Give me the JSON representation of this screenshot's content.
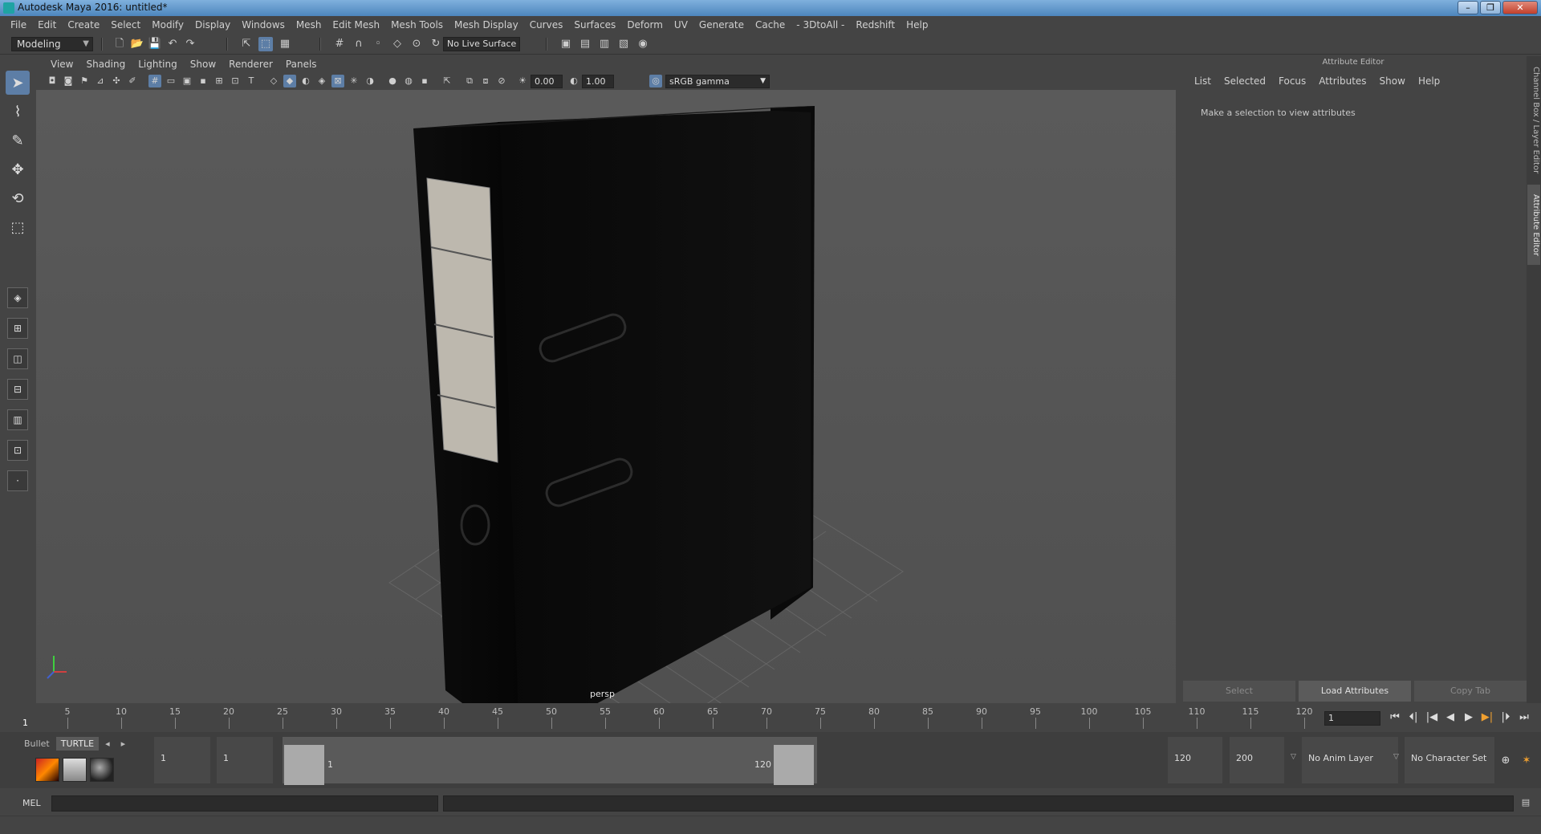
{
  "window": {
    "title": "Autodesk Maya 2016: untitled*",
    "controls": [
      "–",
      "❐",
      "✕"
    ]
  },
  "menubar": {
    "items": [
      "File",
      "Edit",
      "Create",
      "Select",
      "Modify",
      "Display",
      "Windows",
      "Mesh",
      "Edit Mesh",
      "Mesh Tools",
      "Mesh Display",
      "Curves",
      "Surfaces",
      "Deform",
      "UV",
      "Generate",
      "Cache",
      "- 3DtoAll -",
      "Redshift",
      "Help"
    ]
  },
  "statusline": {
    "mode": "Modeling",
    "live_surface": "No Live Surface"
  },
  "viewport": {
    "menus": [
      "View",
      "Shading",
      "Lighting",
      "Show",
      "Renderer",
      "Panels"
    ],
    "exposure": "0.00",
    "gamma": "1.00",
    "color_space": "sRGB gamma",
    "camera": "persp"
  },
  "attribute_editor": {
    "title": "Attribute Editor",
    "menus": [
      "List",
      "Selected",
      "Focus",
      "Attributes",
      "Show",
      "Help"
    ],
    "hint": "Make a selection to view attributes",
    "buttons": [
      "Select",
      "Load Attributes",
      "Copy Tab"
    ],
    "side_tabs": [
      "Channel Box / Layer Editor",
      "Attribute Editor"
    ]
  },
  "timeline": {
    "ticks": [
      5,
      10,
      15,
      20,
      25,
      30,
      35,
      40,
      45,
      50,
      55,
      60,
      65,
      70,
      75,
      80,
      85,
      90,
      95,
      100,
      105,
      110,
      115,
      120
    ],
    "start_label": "1",
    "current_frame": "1",
    "playback": [
      "⏮",
      "⏴|",
      "|◀",
      "◀",
      "▶",
      "▶|",
      "|⏵",
      "⏭"
    ]
  },
  "range": {
    "shelf_tabs": [
      "Bullet",
      "TURTLE"
    ],
    "start_time": "1",
    "playback_start": "1",
    "range_start_label": "1",
    "range_end_label": "120",
    "playback_end": "120",
    "end_time": "200",
    "anim_layer": "No Anim Layer",
    "character_set": "No Character Set"
  },
  "cmdline": {
    "label": "MEL"
  },
  "colors": {
    "accent": "#5d7ea6",
    "background": "#444444",
    "viewport_bg": "#565656"
  }
}
